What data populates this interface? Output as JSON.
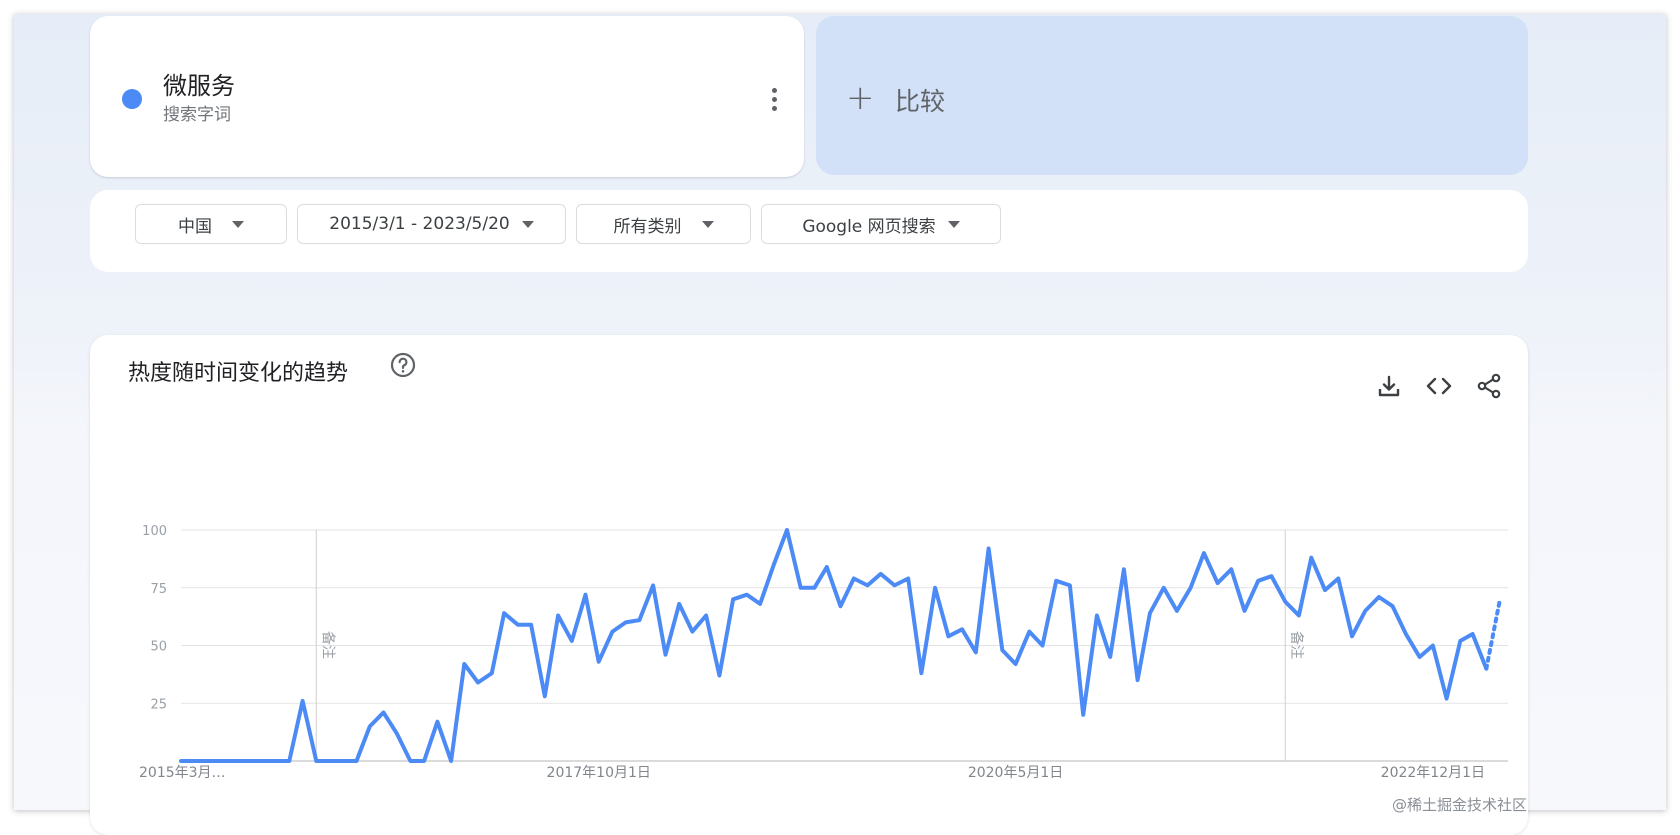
{
  "search_term": {
    "name": "微服务",
    "type": "搜索字词",
    "color": "#4c8bf5"
  },
  "compare": {
    "plus": "+",
    "label": "比较"
  },
  "filters": {
    "region": "中国",
    "date_range": "2015/3/1 - 2023/5/20",
    "category": "所有类别",
    "search_type": "Google 网页搜索"
  },
  "chart": {
    "title": "热度随时间变化的趋势",
    "note_label": "备注"
  },
  "chart_data": {
    "type": "line",
    "title": "热度随时间变化的趋势",
    "xlabel": "",
    "ylabel": "",
    "ylim": [
      0,
      100
    ],
    "yticks": [
      25,
      50,
      75,
      100
    ],
    "y_tick_labels": [
      "25",
      "50",
      "75",
      "100"
    ],
    "x_tick_labels": [
      {
        "label": "2015年3月…",
        "date": "2015-03-01"
      },
      {
        "label": "2017年10月1日",
        "date": "2017-10-01"
      },
      {
        "label": "2020年5月1日",
        "date": "2020-05-01"
      },
      {
        "label": "2022年12月1日",
        "date": "2022-12-01"
      }
    ],
    "annotations": [
      {
        "label": "备注",
        "date": "2016-01-01"
      },
      {
        "label": "备注",
        "date": "2022-01-01"
      }
    ],
    "x_start": "2015-03-01",
    "x_end": "2023-05-20",
    "series": [
      {
        "color": "#4c8bf5",
        "partial_last_value": 70,
        "points": [
          [
            "2015-03-01",
            0
          ],
          [
            "2015-04-01",
            0
          ],
          [
            "2015-05-01",
            0
          ],
          [
            "2015-06-01",
            0
          ],
          [
            "2015-07-01",
            0
          ],
          [
            "2015-08-01",
            0
          ],
          [
            "2015-09-01",
            0
          ],
          [
            "2015-10-01",
            0
          ],
          [
            "2015-11-01",
            0
          ],
          [
            "2015-12-01",
            26
          ],
          [
            "2016-01-01",
            0
          ],
          [
            "2016-02-01",
            0
          ],
          [
            "2016-03-01",
            0
          ],
          [
            "2016-04-01",
            0
          ],
          [
            "2016-05-01",
            15
          ],
          [
            "2016-06-01",
            21
          ],
          [
            "2016-07-01",
            12
          ],
          [
            "2016-08-01",
            0
          ],
          [
            "2016-09-01",
            0
          ],
          [
            "2016-10-01",
            17
          ],
          [
            "2016-11-01",
            0
          ],
          [
            "2016-12-01",
            42
          ],
          [
            "2017-01-01",
            34
          ],
          [
            "2017-02-01",
            38
          ],
          [
            "2017-03-01",
            64
          ],
          [
            "2017-04-01",
            59
          ],
          [
            "2017-05-01",
            59
          ],
          [
            "2017-06-01",
            28
          ],
          [
            "2017-07-01",
            63
          ],
          [
            "2017-08-01",
            52
          ],
          [
            "2017-09-01",
            72
          ],
          [
            "2017-10-01",
            43
          ],
          [
            "2017-11-01",
            56
          ],
          [
            "2017-12-01",
            60
          ],
          [
            "2018-01-01",
            61
          ],
          [
            "2018-02-01",
            76
          ],
          [
            "2018-03-01",
            46
          ],
          [
            "2018-04-01",
            68
          ],
          [
            "2018-05-01",
            56
          ],
          [
            "2018-06-01",
            63
          ],
          [
            "2018-07-01",
            37
          ],
          [
            "2018-08-01",
            70
          ],
          [
            "2018-09-01",
            72
          ],
          [
            "2018-10-01",
            68
          ],
          [
            "2018-11-01",
            85
          ],
          [
            "2018-12-01",
            100
          ],
          [
            "2019-01-01",
            75
          ],
          [
            "2019-02-01",
            75
          ],
          [
            "2019-03-01",
            84
          ],
          [
            "2019-04-01",
            67
          ],
          [
            "2019-05-01",
            79
          ],
          [
            "2019-06-01",
            76
          ],
          [
            "2019-07-01",
            81
          ],
          [
            "2019-08-01",
            76
          ],
          [
            "2019-09-01",
            79
          ],
          [
            "2019-10-01",
            38
          ],
          [
            "2019-11-01",
            75
          ],
          [
            "2019-12-01",
            54
          ],
          [
            "2020-01-01",
            57
          ],
          [
            "2020-02-01",
            47
          ],
          [
            "2020-03-01",
            92
          ],
          [
            "2020-04-01",
            48
          ],
          [
            "2020-05-01",
            42
          ],
          [
            "2020-06-01",
            56
          ],
          [
            "2020-07-01",
            50
          ],
          [
            "2020-08-01",
            78
          ],
          [
            "2020-09-01",
            76
          ],
          [
            "2020-10-01",
            20
          ],
          [
            "2020-11-01",
            63
          ],
          [
            "2020-12-01",
            45
          ],
          [
            "2021-01-01",
            83
          ],
          [
            "2021-02-01",
            35
          ],
          [
            "2021-03-01",
            64
          ],
          [
            "2021-04-01",
            75
          ],
          [
            "2021-05-01",
            65
          ],
          [
            "2021-06-01",
            75
          ],
          [
            "2021-07-01",
            90
          ],
          [
            "2021-08-01",
            77
          ],
          [
            "2021-09-01",
            83
          ],
          [
            "2021-10-01",
            65
          ],
          [
            "2021-11-01",
            78
          ],
          [
            "2021-12-01",
            80
          ],
          [
            "2022-01-01",
            69
          ],
          [
            "2022-02-01",
            63
          ],
          [
            "2022-03-01",
            88
          ],
          [
            "2022-04-01",
            74
          ],
          [
            "2022-05-01",
            79
          ],
          [
            "2022-06-01",
            54
          ],
          [
            "2022-07-01",
            65
          ],
          [
            "2022-08-01",
            71
          ],
          [
            "2022-09-01",
            67
          ],
          [
            "2022-10-01",
            55
          ],
          [
            "2022-11-01",
            45
          ],
          [
            "2022-12-01",
            50
          ],
          [
            "2023-01-01",
            27
          ],
          [
            "2023-02-01",
            52
          ],
          [
            "2023-03-01",
            55
          ],
          [
            "2023-04-01",
            40
          ]
        ]
      }
    ]
  },
  "watermark": "@稀土掘金技术社区"
}
